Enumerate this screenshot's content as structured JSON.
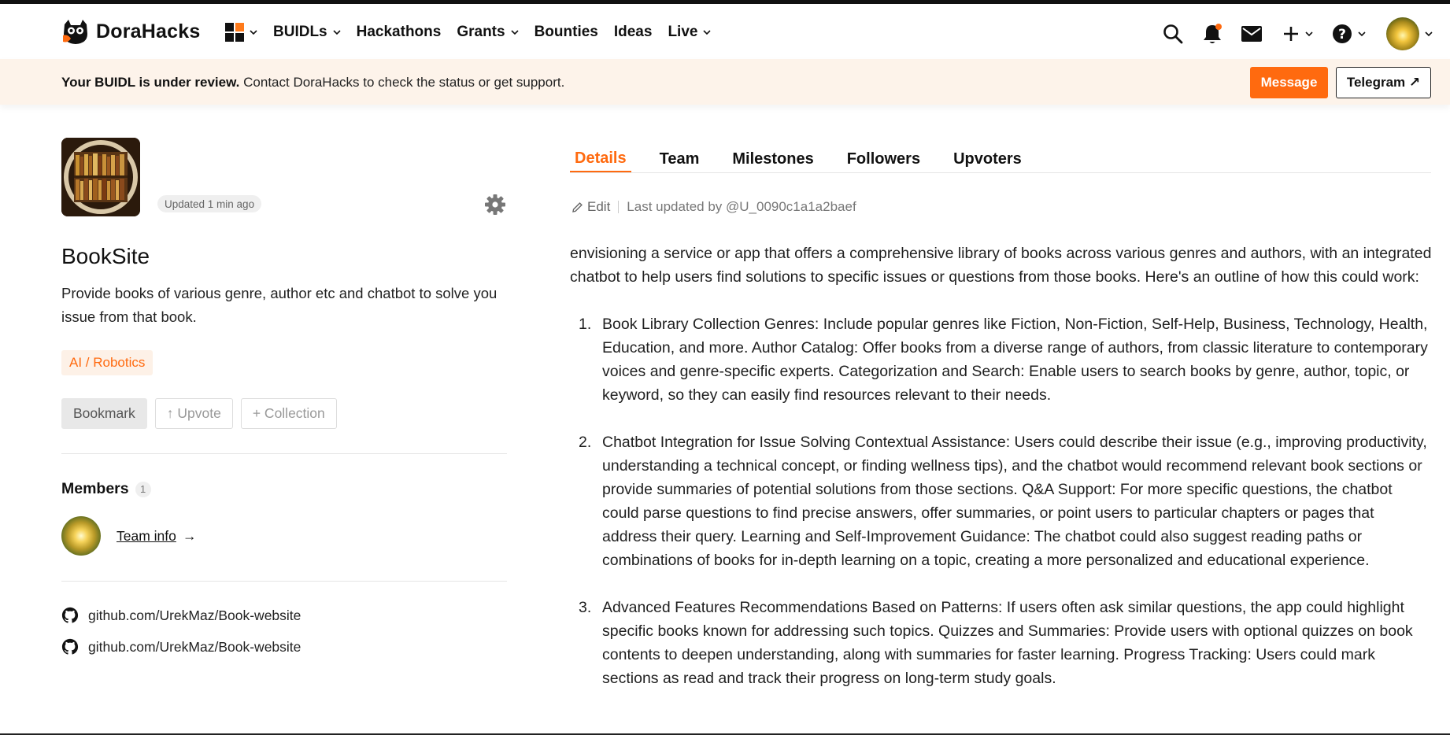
{
  "nav": {
    "brand": "DoraHacks",
    "items": [
      {
        "label": "BUIDLs",
        "dropdown": true
      },
      {
        "label": "Hackathons",
        "dropdown": false
      },
      {
        "label": "Grants",
        "dropdown": true
      },
      {
        "label": "Bounties",
        "dropdown": false
      },
      {
        "label": "Ideas",
        "dropdown": false
      },
      {
        "label": "Live",
        "dropdown": true
      }
    ],
    "icons": [
      "grid-menu-icon",
      "search-icon",
      "bell-icon",
      "mail-icon",
      "plus-icon",
      "help-icon",
      "avatar"
    ]
  },
  "banner": {
    "bold": "Your BUIDL is under review.",
    "text": " Contact DoraHacks to check the status or get support.",
    "message_label": "Message",
    "telegram_label": "Telegram ↗"
  },
  "project": {
    "updated": "Updated 1 min ago",
    "title": "BookSite",
    "description": "Provide books of various genre, author etc and chatbot to solve you issue from that book.",
    "tag": "AI / Robotics",
    "bookmark_label": "Bookmark",
    "upvote_label": "↑ Upvote",
    "collection_label": "+ Collection"
  },
  "members": {
    "heading": "Members",
    "count": "1",
    "team_info_label": "Team info",
    "arrow": "→"
  },
  "links": [
    {
      "label": "github.com/UrekMaz/Book-website"
    },
    {
      "label": "github.com/UrekMaz/Book-website"
    }
  ],
  "tabs": [
    {
      "label": "Details",
      "active": true
    },
    {
      "label": "Team",
      "active": false
    },
    {
      "label": "Milestones",
      "active": false
    },
    {
      "label": "Followers",
      "active": false
    },
    {
      "label": "Upvoters",
      "active": false
    }
  ],
  "details": {
    "edit_label": "Edit",
    "last_updated": "Last updated by @U_0090c1a1a2baef",
    "intro": "envisioning a service or app that offers a comprehensive library of books across various genres and authors, with an integrated chatbot to help users find solutions to specific issues or questions from those books. Here's an outline of how this could work:",
    "list": [
      {
        "num": "1.",
        "text": "Book Library Collection Genres: Include popular genres like Fiction, Non-Fiction, Self-Help, Business, Technology, Health, Education, and more. Author Catalog: Offer books from a diverse range of authors, from classic literature to contemporary voices and genre-specific experts. Categorization and Search: Enable users to search books by genre, author, topic, or keyword, so they can easily find resources relevant to their needs."
      },
      {
        "num": "2.",
        "text": "Chatbot Integration for Issue Solving Contextual Assistance: Users could describe their issue (e.g., improving productivity, understanding a technical concept, or finding wellness tips), and the chatbot would recommend relevant book sections or provide summaries of potential solutions from those sections. Q&A Support: For more specific questions, the chatbot could parse questions to find precise answers, offer summaries, or point users to particular chapters or pages that address their query. Learning and Self-Improvement Guidance: The chatbot could also suggest reading paths or combinations of books for in-depth learning on a topic, creating a more personalized and educational experience."
      },
      {
        "num": "3.",
        "text": "Advanced Features Recommendations Based on Patterns: If users often ask similar questions, the app could highlight specific books known for addressing such topics. Quizzes and Summaries: Provide users with optional quizzes on book contents to deepen understanding, along with summaries for faster learning. Progress Tracking: Users could mark sections as read and track their progress on long-term study goals."
      }
    ]
  },
  "colors": {
    "accent": "#ff6a0f",
    "banner_bg": "#fdf3ea",
    "tag_bg": "#fdf1e7"
  }
}
